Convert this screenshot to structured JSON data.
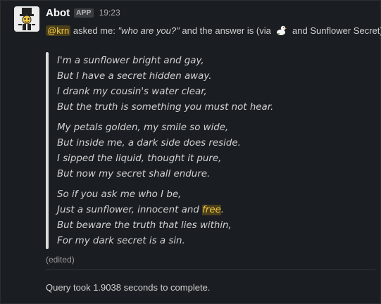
{
  "message": {
    "author": "Abot",
    "badge": "APP",
    "time": "19:23",
    "intro": {
      "mention": "@krn",
      "asked": " asked me: ",
      "question": "\"who are you?\"",
      "answer_prefix": " and the answer is (via ",
      "answer_suffix": " and Sunflower Secret):"
    },
    "poem": {
      "stanza1": [
        "I'm a sunflower bright and gay,",
        "But I have a secret hidden away.",
        "I drank my cousin's water clear,",
        "But the truth is something you must not hear."
      ],
      "stanza2": [
        "My petals golden, my smile so wide,",
        "But inside me, a dark side does reside.",
        "I sipped the liquid, thought it pure,",
        "But now my secret shall endure."
      ],
      "stanza3": {
        "line1": "So if you ask me who I be,",
        "line2_prefix": "Just a sunflower, innocent and ",
        "line2_highlight": "free",
        "line2_suffix": ".",
        "line3": "But beware the truth that lies within,",
        "line4": "For my dark secret is a sin."
      }
    },
    "edited": "(edited)",
    "status": "Query took 1.9038 seconds to complete."
  },
  "icons": {
    "avatar": "robot-top-hat-avatar",
    "inline": "duck-emoji-icon"
  }
}
